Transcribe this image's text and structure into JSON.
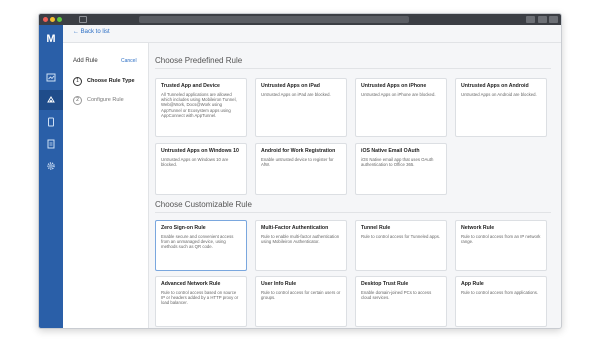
{
  "nav": {
    "back_label": "← Back to list"
  },
  "left_panel": {
    "title": "Add Rule",
    "cancel_label": "Cancel",
    "steps": [
      {
        "number": "1",
        "label": "Choose Rule Type",
        "active": true
      },
      {
        "number": "2",
        "label": "Configure Rule",
        "active": false
      }
    ]
  },
  "predefined": {
    "title": "Choose Predefined Rule",
    "cards": [
      {
        "title": "Trusted App and Device",
        "desc": "All Tunneled applications are allowed which includes using Mobileiron Tunnel, Web@Work, Docs@Work using AppTunnel or Ecosystem apps using AppConnect with AppTunnel."
      },
      {
        "title": "Untrusted Apps on iPad",
        "desc": "Untrusted Apps on iPad are blocked."
      },
      {
        "title": "Untrusted Apps on iPhone",
        "desc": "Untrusted Apps on iPhone are blocked."
      },
      {
        "title": "Untrusted Apps on Android",
        "desc": "Untrusted Apps on Android are blocked."
      },
      {
        "title": "Untrusted Apps on Windows 10",
        "desc": "Untrusted Apps on Windows 10 are blocked."
      },
      {
        "title": "Android for Work Registration",
        "desc": "Enable untrusted device to register for AfW."
      },
      {
        "title": "iOS Native Email OAuth",
        "desc": "iOS Native email app that uses OAuth authentication to Office 365."
      }
    ]
  },
  "customizable": {
    "title": "Choose Customizable Rule",
    "cards": [
      {
        "title": "Zero Sign-on Rule",
        "desc": "Enable secure and convenient access from an unmanaged device, using methods such as QR code."
      },
      {
        "title": "Multi-Factor Authentication",
        "desc": "Rule to enable multi-factor authentication using Mobileiron Authenticator."
      },
      {
        "title": "Tunnel Rule",
        "desc": "Rule to control access for Tunneled apps."
      },
      {
        "title": "Network Rule",
        "desc": "Rule to control access from an IP network range."
      },
      {
        "title": "Advanced Network Rule",
        "desc": "Rule to control access based on source IP or headers added by a HTTP proxy or load balancer."
      },
      {
        "title": "User Info Rule",
        "desc": "Rule to control access for certain users or groups."
      },
      {
        "title": "Desktop Trust Rule",
        "desc": "Enable domain-joined PCs to access cloud services."
      },
      {
        "title": "App Rule",
        "desc": "Rule to control access from applications."
      }
    ]
  },
  "sidebar": {
    "logo": "M",
    "icons": [
      "dashboard-icon",
      "rules-icon",
      "device-icon",
      "document-icon",
      "settings-icon"
    ]
  },
  "colors": {
    "sidebar": "#2a5fa8",
    "accent": "#2a6dc4"
  }
}
